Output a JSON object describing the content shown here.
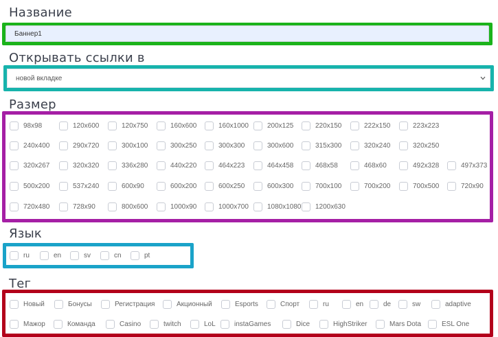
{
  "name_section": {
    "title": "Название",
    "value": "Баннер1"
  },
  "open_links_section": {
    "title": "Открывать ссылки в",
    "selected": "новой вкладке"
  },
  "size_section": {
    "title": "Размер",
    "rows": [
      [
        "98x98",
        "120x600",
        "120x750",
        "160x600",
        "160x1000",
        "200x125",
        "220x150",
        "222x150",
        "223x223"
      ],
      [
        "240x400",
        "290x720",
        "300x100",
        "300x250",
        "300x300",
        "300x600",
        "315x300",
        "320x240",
        "320x250"
      ],
      [
        "320x267",
        "320x320",
        "336x280",
        "440x220",
        "464x223",
        "464x458",
        "468x58",
        "468x60",
        "492x328",
        "497x373"
      ],
      [
        "500x200",
        "537x240",
        "600x90",
        "600x200",
        "600x250",
        "600x300",
        "700x100",
        "700x200",
        "700x500",
        "720x90"
      ],
      [
        "720x480",
        "728x90",
        "800x600",
        "1000x90",
        "1000x700",
        "1080x1080",
        "1200x630"
      ]
    ]
  },
  "language_section": {
    "title": "Язык",
    "options": [
      "ru",
      "en",
      "sv",
      "cn",
      "pt"
    ]
  },
  "tag_section": {
    "title": "Тег",
    "rows": [
      [
        "Новый",
        "Бонусы",
        "Регистрация",
        "Акционный",
        "Esports",
        "Спорт",
        "ru",
        "en",
        "de",
        "sw",
        "adaptive"
      ],
      [
        "Мажор",
        "Команда",
        "Casino",
        "twitch",
        "LoL",
        "instaGames",
        "Dice",
        "HighStriker",
        "Mars Dota",
        "ESL One"
      ]
    ]
  },
  "colors": {
    "green_frame": "#1bb31b",
    "teal_frame": "#17b3ac",
    "magenta_frame": "#a51fa5",
    "blue_frame": "#1aa3c9",
    "red_frame": "#b3001b"
  },
  "icons": {
    "select_arrow": "chevron-down-icon"
  }
}
